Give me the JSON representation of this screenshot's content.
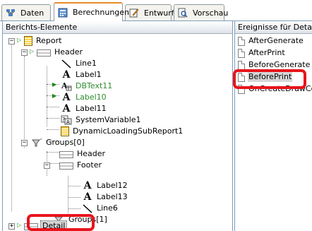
{
  "tabs": [
    {
      "label": "Daten",
      "icon": "data-icon",
      "active": false
    },
    {
      "label": "Berechnungen",
      "icon": "calculator-icon",
      "active": true
    },
    {
      "label": "Entwurf",
      "icon": "design-icon",
      "active": false
    },
    {
      "label": "Vorschau",
      "icon": "preview-icon",
      "active": false
    }
  ],
  "left_panel": {
    "title": "Berichts-Elemente",
    "tree": [
      {
        "label": "Report",
        "icon": "report-icon"
      },
      {
        "label": "Header",
        "icon": "band-icon"
      },
      {
        "label": "Line1",
        "icon": "line-icon"
      },
      {
        "label": "Label1",
        "icon": "label-icon"
      },
      {
        "label": "DBText11",
        "icon": "dbtext-icon",
        "color": "#2e8b2e"
      },
      {
        "label": "Label10",
        "icon": "label-icon",
        "color": "#2e8b2e"
      },
      {
        "label": "Label11",
        "icon": "label-icon"
      },
      {
        "label": "SystemVariable1",
        "icon": "system-variable-icon"
      },
      {
        "label": "DynamicLoadingSubReport1",
        "icon": "subreport-icon"
      },
      {
        "label": "Groups[0]",
        "icon": "group-icon"
      },
      {
        "label": "Header",
        "icon": "band-icon"
      },
      {
        "label": "Footer",
        "icon": "band-icon"
      },
      {
        "label": "Label12",
        "icon": "label-icon"
      },
      {
        "label": "Label13",
        "icon": "label-icon"
      },
      {
        "label": "Line6",
        "icon": "line-icon"
      },
      {
        "label": "Groups[1]",
        "icon": "group-icon"
      },
      {
        "label": "Detail",
        "icon": "band-icon",
        "selected": true
      }
    ]
  },
  "right_panel": {
    "title": "Ereignisse für Detailb",
    "events": [
      "AfterGenerate",
      "AfterPrint",
      "BeforeGenerate",
      "BeforePrint",
      "OnCreateDrawCo"
    ],
    "selected_event": "BeforePrint"
  },
  "colors": {
    "highlight": "#e8141c",
    "tab_accent": "#e68b2c",
    "green_text": "#2e8b2e"
  }
}
